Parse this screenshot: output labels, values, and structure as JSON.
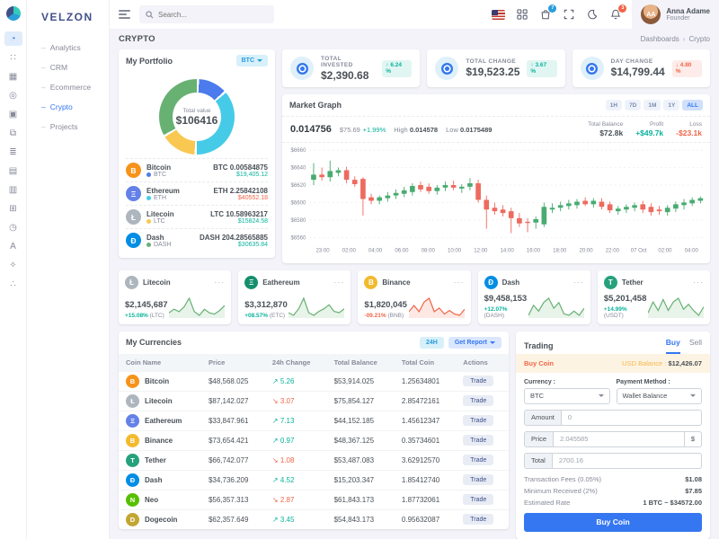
{
  "brand": {
    "name": "VELZON"
  },
  "ui": {
    "menu_dots": "···"
  },
  "topbar": {
    "search_placeholder": "Search...",
    "cart_badge": "7",
    "notification_badge": "3",
    "user": {
      "name": "Anna Adame",
      "role": "Founder",
      "initials": "AA"
    }
  },
  "page": {
    "title": "CRYPTO",
    "breadcrumb": [
      "Dashboards",
      "Crypto"
    ]
  },
  "sidebar": {
    "rail_icons": [
      "dashboards",
      "apps",
      "layouts",
      "pages",
      "authentication",
      "widgets",
      "forms",
      "tables",
      "charts",
      "icons",
      "maps",
      "multilevel",
      "components",
      "share"
    ],
    "items": [
      {
        "label": "Analytics",
        "active": false
      },
      {
        "label": "CRM",
        "active": false
      },
      {
        "label": "Ecommerce",
        "active": false
      },
      {
        "label": "Crypto",
        "active": true
      },
      {
        "label": "Projects",
        "active": false
      }
    ]
  },
  "stats": [
    {
      "label": "TOTAL INVESTED",
      "value": "$2,390.68",
      "change": "6.24 %",
      "direction": "up"
    },
    {
      "label": "TOTAL CHANGE",
      "value": "$19,523.25",
      "change": "3.67 %",
      "direction": "up"
    },
    {
      "label": "DAY CHANGE",
      "value": "$14,799.44",
      "change": "4.80 %",
      "direction": "down"
    }
  ],
  "portfolio": {
    "title": "My Portfolio",
    "currency_select": "BTC",
    "total_label": "Total value",
    "total_value": "$106416",
    "donut": [
      {
        "name": "Bitcoin",
        "color": "#4b7bec",
        "pct": 13
      },
      {
        "name": "Ethereum",
        "color": "#45cbe8",
        "pct": 37
      },
      {
        "name": "Litecoin",
        "color": "#f9c851",
        "pct": 16
      },
      {
        "name": "Dash",
        "color": "#67b173",
        "pct": 34
      }
    ],
    "coins": [
      {
        "name": "Bitcoin",
        "ticker": "BTC",
        "icon": "B",
        "icon_bg": "#f7931a",
        "dot": "#4b7bec",
        "amount": "BTC 0.00584875",
        "value": "$19,405.12",
        "trend": "up"
      },
      {
        "name": "Ethereum",
        "ticker": "ETH",
        "icon": "Ξ",
        "icon_bg": "#6481e7",
        "dot": "#45cbe8",
        "amount": "ETH 2.25842108",
        "value": "$40552.18",
        "trend": "down"
      },
      {
        "name": "Litecoin",
        "ticker": "LTC",
        "icon": "Ł",
        "icon_bg": "#adb5bd",
        "dot": "#f9c851",
        "amount": "LTC 10.58963217",
        "value": "$15824.58",
        "trend": "up"
      },
      {
        "name": "Dash",
        "ticker": "DASH",
        "icon": "Đ",
        "icon_bg": "#008de4",
        "dot": "#67b173",
        "amount": "DASH 204.28565885",
        "value": "$30635.84",
        "trend": "up"
      }
    ]
  },
  "market": {
    "title": "Market Graph",
    "ranges": [
      "1H",
      "7D",
      "1M",
      "1Y",
      "ALL"
    ],
    "active_range": "ALL",
    "price": "0.014756",
    "price_usd": "$75.69",
    "price_change": "+1.99%",
    "high_label": "High",
    "high": "0.014578",
    "low_label": "Low",
    "low": "0.0175489",
    "total_balance_label": "Total Balance",
    "total_balance": "$72.8k",
    "profit_label": "Profit",
    "profit": "+$49.7k",
    "loss_label": "Loss",
    "loss": "-$23.1k"
  },
  "chart_data": {
    "type": "candlestick",
    "title": "Market Graph",
    "ylim": [
      6560,
      6660
    ],
    "y_ticks": [
      "$6660",
      "$6640",
      "$6620",
      "$6600",
      "$6580",
      "$6560"
    ],
    "x_ticks": [
      "23:00",
      "02:00",
      "04:00",
      "06:00",
      "08:00",
      "10:00",
      "12:00",
      "14:00",
      "16:00",
      "18:00",
      "20:00",
      "22:00",
      "07 Oct",
      "02:00",
      "04:00"
    ],
    "up_color": "#49ab71",
    "down_color": "#ee6a5f",
    "candles": [
      [
        6626,
        6645,
        6620,
        6632
      ],
      [
        6632,
        6640,
        6625,
        6629
      ],
      [
        6629,
        6648,
        6624,
        6636
      ],
      [
        6634,
        6640,
        6630,
        6637
      ],
      [
        6637,
        6641,
        6622,
        6626
      ],
      [
        6626,
        6630,
        6618,
        6621
      ],
      [
        6627,
        6629,
        6585,
        6604
      ],
      [
        6606,
        6610,
        6598,
        6602
      ],
      [
        6602,
        6608,
        6598,
        6606
      ],
      [
        6605,
        6612,
        6601,
        6608
      ],
      [
        6608,
        6615,
        6604,
        6611
      ],
      [
        6610,
        6618,
        6606,
        6614
      ],
      [
        6612,
        6622,
        6608,
        6619
      ],
      [
        6620,
        6624,
        6612,
        6615
      ],
      [
        6618,
        6622,
        6610,
        6613
      ],
      [
        6613,
        6620,
        6609,
        6617
      ],
      [
        6617,
        6624,
        6613,
        6620
      ],
      [
        6620,
        6625,
        6614,
        6617
      ],
      [
        6616,
        6621,
        6611,
        6618
      ],
      [
        6618,
        6628,
        6614,
        6622
      ],
      [
        6622,
        6626,
        6600,
        6603
      ],
      [
        6603,
        6608,
        6570,
        6592
      ],
      [
        6594,
        6600,
        6586,
        6590
      ],
      [
        6592,
        6597,
        6584,
        6588
      ],
      [
        6590,
        6594,
        6565,
        6582
      ],
      [
        6582,
        6588,
        6572,
        6576
      ],
      [
        6578,
        6582,
        6566,
        6577
      ],
      [
        6577,
        6584,
        6570,
        6581
      ],
      [
        6575,
        6600,
        6572,
        6595
      ],
      [
        6592,
        6599,
        6588,
        6594
      ],
      [
        6594,
        6601,
        6590,
        6597
      ],
      [
        6596,
        6603,
        6592,
        6599
      ],
      [
        6597,
        6604,
        6593,
        6601
      ],
      [
        6602,
        6606,
        6596,
        6598
      ],
      [
        6598,
        6605,
        6594,
        6602
      ],
      [
        6601,
        6605,
        6592,
        6595
      ],
      [
        6598,
        6601,
        6588,
        6591
      ],
      [
        6590,
        6596,
        6586,
        6593
      ],
      [
        6592,
        6598,
        6588,
        6595
      ],
      [
        6594,
        6600,
        6590,
        6597
      ],
      [
        6598,
        6602,
        6588,
        6592
      ],
      [
        6595,
        6599,
        6585,
        6589
      ],
      [
        6592,
        6596,
        6586,
        6590
      ],
      [
        6589,
        6597,
        6585,
        6594
      ],
      [
        6593,
        6601,
        6589,
        6598
      ],
      [
        6597,
        6604,
        6592,
        6600
      ],
      [
        6599,
        6606,
        6596,
        6603
      ],
      [
        6602,
        6607,
        6599,
        6605
      ]
    ]
  },
  "coin_cards": [
    {
      "name": "Litecoin",
      "icon": "Ł",
      "icon_bg": "#adb5bd",
      "value": "$2,145,687",
      "change": "+15.08%",
      "ticker": "(LTC)",
      "trend": "up",
      "spark": [
        8,
        11,
        9,
        13,
        20,
        9,
        6,
        11,
        8,
        7,
        10,
        14
      ]
    },
    {
      "name": "Eathereum",
      "icon": "Ξ",
      "icon_bg": "#148f6d",
      "value": "$3,312,870",
      "change": "+08.57%",
      "ticker": "(ETC)",
      "trend": "up",
      "spark": [
        9,
        7,
        12,
        20,
        9,
        7,
        10,
        12,
        15,
        10,
        9,
        12
      ]
    },
    {
      "name": "Binance",
      "icon": "B",
      "icon_bg": "#f3ba2f",
      "value": "$1,820,045",
      "change": "-09.21%",
      "ticker": "(BNB)",
      "trend": "down",
      "spark": [
        9,
        14,
        9,
        17,
        20,
        9,
        12,
        7,
        10,
        7,
        6,
        11
      ]
    },
    {
      "name": "Dash",
      "icon": "Đ",
      "icon_bg": "#008de4",
      "value": "$9,458,153",
      "change": "+12.07%",
      "ticker": "(DASH)",
      "trend": "up",
      "spark": [
        7,
        14,
        10,
        16,
        19,
        12,
        16,
        8,
        7,
        10,
        7,
        12
      ]
    },
    {
      "name": "Tether",
      "icon": "T",
      "icon_bg": "#26a17b",
      "value": "$5,201,458",
      "change": "+14.99%",
      "ticker": "(USDT)",
      "trend": "up",
      "spark": [
        7,
        16,
        9,
        18,
        9,
        16,
        19,
        10,
        14,
        9,
        5,
        12
      ]
    }
  ],
  "currencies": {
    "title": "My Currencies",
    "range_button": "24H",
    "report_button": "Get Report",
    "action_label": "Trade",
    "columns": [
      "Coin Name",
      "Price",
      "24h Change",
      "Total Balance",
      "Total Coin",
      "Actions"
    ],
    "rows": [
      {
        "name": "Bitcoin",
        "icon": "B",
        "icon_bg": "#f7931a",
        "price": "$48,568.025",
        "change": "5.26",
        "trend": "up",
        "balance": "$53,914.025",
        "coins": "1.25634801"
      },
      {
        "name": "Litecoin",
        "icon": "Ł",
        "icon_bg": "#adb5bd",
        "price": "$87,142.027",
        "change": "3.07",
        "trend": "down",
        "balance": "$75,854.127",
        "coins": "2.85472161"
      },
      {
        "name": "Eathereum",
        "icon": "Ξ",
        "icon_bg": "#6481e7",
        "price": "$33,847.961",
        "change": "7.13",
        "trend": "up",
        "balance": "$44,152.185",
        "coins": "1.45612347"
      },
      {
        "name": "Binance",
        "icon": "B",
        "icon_bg": "#f3ba2f",
        "price": "$73,654.421",
        "change": "0.97",
        "trend": "up",
        "balance": "$48,367.125",
        "coins": "0.35734601"
      },
      {
        "name": "Tether",
        "icon": "T",
        "icon_bg": "#26a17b",
        "price": "$66,742.077",
        "change": "1.08",
        "trend": "down",
        "balance": "$53,487.083",
        "coins": "3.62912570"
      },
      {
        "name": "Dash",
        "icon": "Đ",
        "icon_bg": "#008de4",
        "price": "$34,736.209",
        "change": "4.52",
        "trend": "up",
        "balance": "$15,203.347",
        "coins": "1.85412740"
      },
      {
        "name": "Neo",
        "icon": "N",
        "icon_bg": "#58bf00",
        "price": "$56,357.313",
        "change": "2.87",
        "trend": "down",
        "balance": "$61,843.173",
        "coins": "1.87732061"
      },
      {
        "name": "Dogecoin",
        "icon": "D",
        "icon_bg": "#c2a633",
        "price": "$62,357.649",
        "change": "3.45",
        "trend": "up",
        "balance": "$54,843.173",
        "coins": "0.95632087"
      }
    ]
  },
  "trading": {
    "title": "Trading",
    "tabs": [
      "Buy",
      "Sell"
    ],
    "active_tab": "Buy",
    "banner_label": "Buy Coin",
    "balance_label": "USD Balance :",
    "balance": "$12,426.07",
    "currency_label": "Currency :",
    "currency": "BTC",
    "payment_label": "Payment Method :",
    "payment": "Wallet Balance",
    "amount_label": "Amount",
    "amount_value": "0",
    "price_label": "Price",
    "price_value": "2.045585",
    "price_suffix": "$",
    "total_label": "Total",
    "total_value": "2700.16",
    "fees_label": "Transaction Fees (0.05%)",
    "fees": "$1.08",
    "min_label": "Minimum Received (2%)",
    "min": "$7.85",
    "rate_label": "Estimated Rate",
    "rate": "1 BTC ~ $34572.00",
    "button": "Buy Coin"
  }
}
